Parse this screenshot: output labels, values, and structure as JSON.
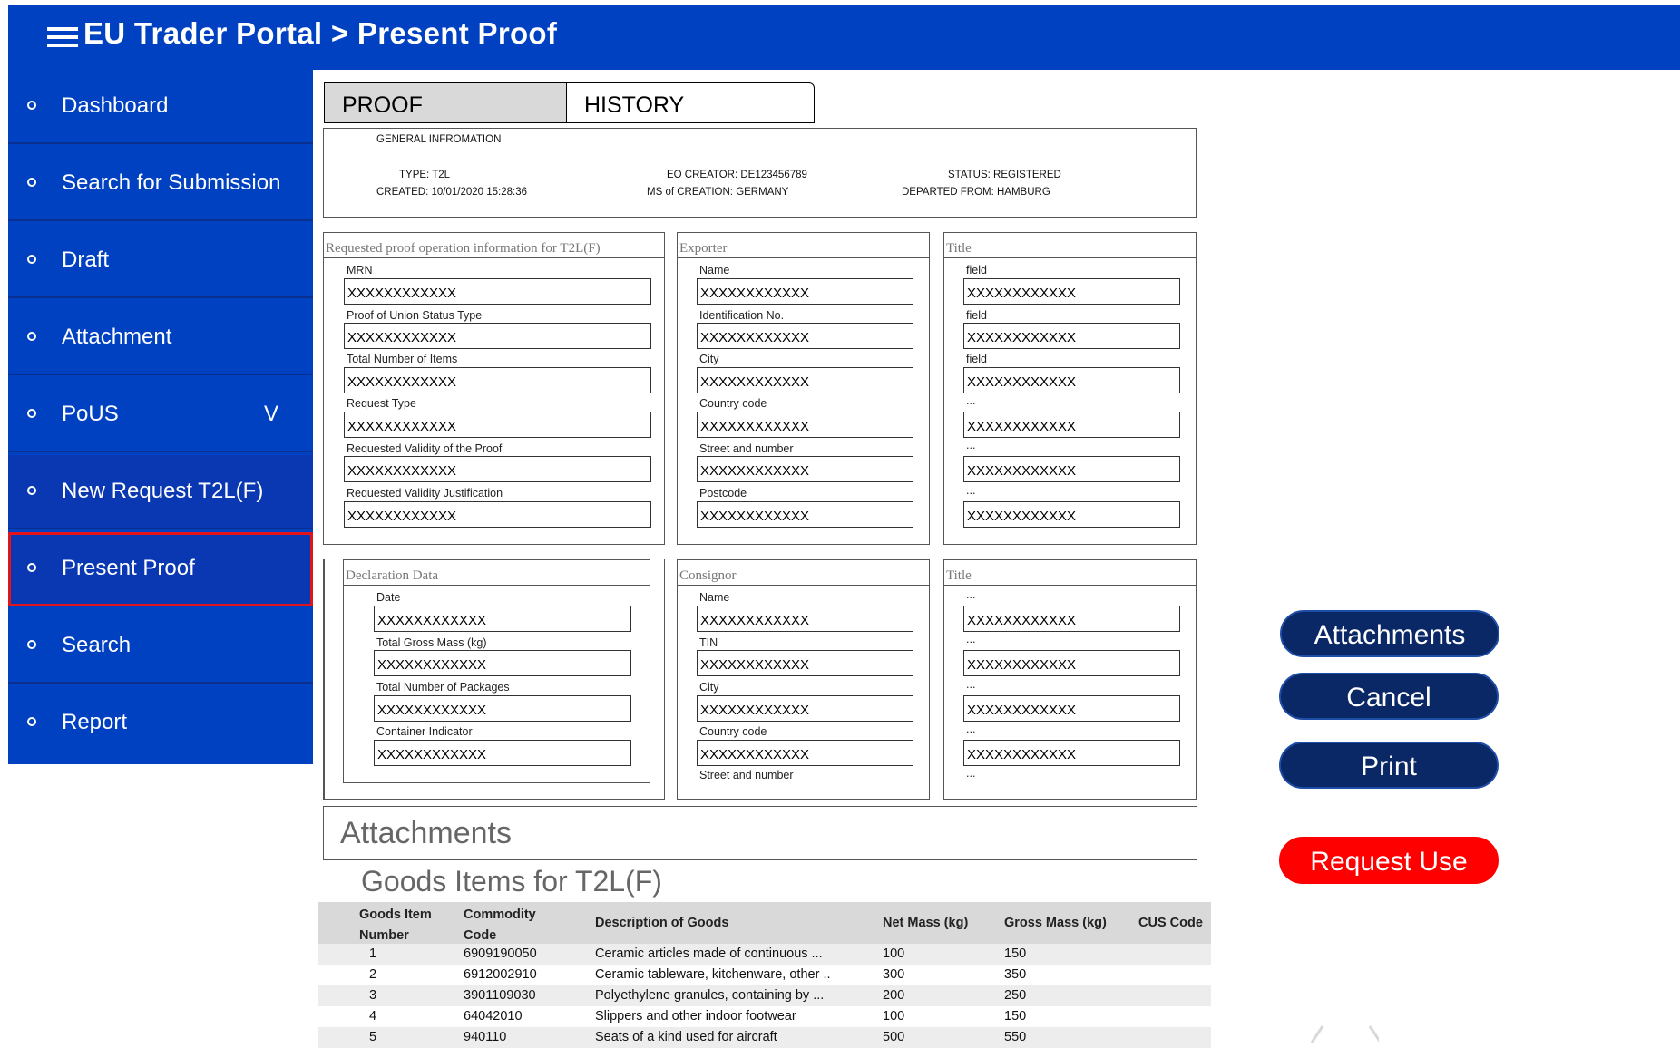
{
  "header": {
    "title": "EU Trader Portal > Present Proof"
  },
  "sidebar": {
    "items": [
      {
        "label": "Dashboard"
      },
      {
        "label": "Search for Submission"
      },
      {
        "label": "Draft"
      },
      {
        "label": "Attachment"
      },
      {
        "label": "PoUS",
        "chevron": "V"
      },
      {
        "label": "New Request T2L(F)"
      },
      {
        "label": "Present Proof"
      },
      {
        "label": "Search"
      },
      {
        "label": "Report"
      }
    ]
  },
  "tabs": [
    {
      "label": "PROOF"
    },
    {
      "label": "HISTORY"
    }
  ],
  "general_info": {
    "heading": "GENERAL INFROMATION",
    "type": "TYPE: T2L",
    "created": "CREATED: 10/01/2020  15:28:36",
    "eo_creator": "EO CREATOR: DE123456789",
    "ms_creation": "MS of CREATION: GERMANY",
    "status": "STATUS: REGISTERED",
    "departed": "DEPARTED FROM: HAMBURG"
  },
  "panels": {
    "requested": {
      "title": "Requested proof operation information for T2L(F)",
      "fields": [
        {
          "label": "MRN",
          "value": "XXXXXXXXXXXX"
        },
        {
          "label": "Proof of Union Status Type",
          "value": "XXXXXXXXXXXX"
        },
        {
          "label": "Total Number of Items",
          "value": "XXXXXXXXXXXX"
        },
        {
          "label": "Request Type",
          "value": "XXXXXXXXXXXX"
        },
        {
          "label": "Requested Validity of the Proof",
          "value": "XXXXXXXXXXXX"
        },
        {
          "label": "Requested Validity Justification",
          "value": "XXXXXXXXXXXX"
        }
      ]
    },
    "exporter": {
      "title": "Exporter",
      "fields": [
        {
          "label": "Name",
          "value": "XXXXXXXXXXXX"
        },
        {
          "label": "Identification No.",
          "value": "XXXXXXXXXXXX"
        },
        {
          "label": "City",
          "value": "XXXXXXXXXXXX"
        },
        {
          "label": "Country code",
          "value": "XXXXXXXXXXXX"
        },
        {
          "label": "Street and number",
          "value": "XXXXXXXXXXXX"
        },
        {
          "label": "Postcode",
          "value": "XXXXXXXXXXXX"
        }
      ]
    },
    "title1": {
      "title": "Title",
      "fields": [
        {
          "label": "field",
          "value": "XXXXXXXXXXXX"
        },
        {
          "label": "field",
          "value": "XXXXXXXXXXXX"
        },
        {
          "label": "field",
          "value": "XXXXXXXXXXXX"
        },
        {
          "label": "...",
          "value": "XXXXXXXXXXXX"
        },
        {
          "label": "...",
          "value": "XXXXXXXXXXXX"
        },
        {
          "label": "...",
          "value": "XXXXXXXXXXXX"
        }
      ]
    },
    "declaration": {
      "title": "Declaration Data",
      "fields": [
        {
          "label": "Date",
          "value": "XXXXXXXXXXXX"
        },
        {
          "label": "Total Gross Mass (kg)",
          "value": "XXXXXXXXXXXX"
        },
        {
          "label": "Total Number of Packages",
          "value": "XXXXXXXXXXXX"
        },
        {
          "label": "Container Indicator",
          "value": "XXXXXXXXXXXX"
        }
      ]
    },
    "consignor": {
      "title": "Consignor",
      "fields": [
        {
          "label": "Name",
          "value": "XXXXXXXXXXXX"
        },
        {
          "label": "TIN",
          "value": "XXXXXXXXXXXX"
        },
        {
          "label": "City",
          "value": "XXXXXXXXXXXX"
        },
        {
          "label": "Country code",
          "value": "XXXXXXXXXXXX"
        }
      ],
      "trailing_label": "Street and number"
    },
    "title2": {
      "title": "Title",
      "fields": [
        {
          "label": "...",
          "value": "XXXXXXXXXXXX"
        },
        {
          "label": "...",
          "value": "XXXXXXXXXXXX"
        },
        {
          "label": "...",
          "value": "XXXXXXXXXXXX"
        },
        {
          "label": "...",
          "value": "XXXXXXXXXXXX"
        }
      ],
      "trailing_label": "..."
    }
  },
  "attachments": {
    "title": "Attachments"
  },
  "goods": {
    "title": "Goods Items  for T2L(F)",
    "headers": {
      "item_number": [
        "Goods Item",
        "Number"
      ],
      "commodity": [
        "Commodity",
        "Code"
      ],
      "description": "Description of Goods",
      "net_mass": "Net Mass (kg)",
      "gross_mass": "Gross Mass (kg)",
      "cus": "CUS Code"
    },
    "rows": [
      {
        "num": "1",
        "code": "6909190050",
        "desc": "Ceramic articles made of continuous ...",
        "net": "100",
        "gross": "150"
      },
      {
        "num": "2",
        "code": "6912002910",
        "desc": "Ceramic tableware, kitchenware, other ..",
        "net": "300",
        "gross": "350"
      },
      {
        "num": "3",
        "code": "3901109030",
        "desc": "Polyethylene granules, containing by ...",
        "net": "200",
        "gross": "250"
      },
      {
        "num": "4",
        "code": "64042010",
        "desc": "Slippers and other indoor footwear",
        "net": "100",
        "gross": "150"
      },
      {
        "num": "5",
        "code": "940110",
        "desc": "Seats of a kind used for aircraft",
        "net": "500",
        "gross": "550"
      }
    ]
  },
  "actions": {
    "attachments": "Attachments",
    "cancel": "Cancel",
    "print": "Print",
    "request_use": "Request Use"
  }
}
